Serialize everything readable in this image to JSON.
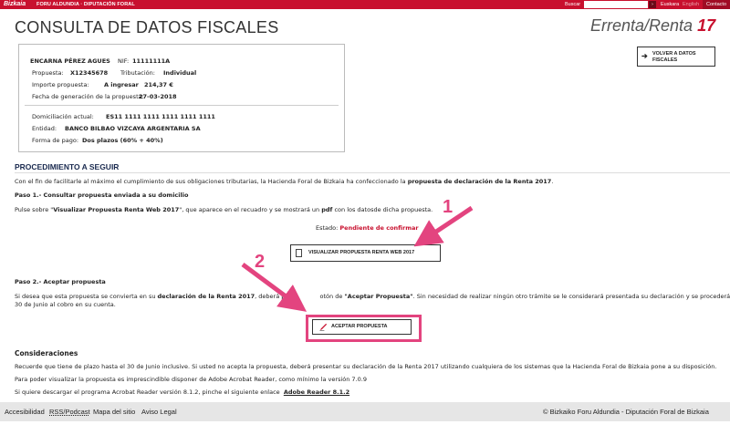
{
  "topbar": {
    "logo": "Bizkaia",
    "org": "FORU ALDUNDIA · DIPUTACIÓN FORAL",
    "search_label": "Buscar",
    "search_go": "›",
    "lang_eu": "Euskara",
    "lang_en": "English",
    "contact": "Contacto"
  },
  "header": {
    "title": "CONSULTA DE DATOS FISCALES",
    "brand_main": "Errenta/Renta",
    "brand_year": "17",
    "back_button": "VOLVER A DATOS FISCALES"
  },
  "info": {
    "name": "ENCARNA PÉREZ AGUES",
    "nif_label": "NIF:",
    "nif": "11111111A",
    "propuesta_label": "Propuesta:",
    "propuesta": "X12345678",
    "tributacion_label": "Tributación:",
    "tributacion": "Individual",
    "importe_label": "Importe propuesta:",
    "importe_tipo": "A ingresar",
    "importe": "214,37 €",
    "fecha_label": "Fecha de generación de la propuesta:",
    "fecha": "27-03-2018",
    "domiciliacion_label": "Domiciliación actual:",
    "domiciliacion": "ES11 1111 1111 1111 1111 1111",
    "entidad_label": "Entidad:",
    "entidad": "BANCO BILBAO VIZCAYA ARGENTARIA SA",
    "forma_label": "Forma de pago:",
    "forma": "Dos plazos (60% + 40%)"
  },
  "procedure": {
    "heading": "PROCEDIMIENTO A SEGUIR",
    "intro_a": "Con el fin de facilitarle al máximo el cumplimiento de sus obligaciones tributarias, la Hacienda Foral de Bizkaia ha confeccionado la ",
    "intro_b": "propuesta de declaración de la Renta 2017",
    "intro_c": ".",
    "step1_title": "Paso 1.- Consultar propuesta enviada a su domicilio",
    "step1_a": "Pulse sobre \"",
    "step1_b": "Visualizar Propuesta Renta Web 2017",
    "step1_c": "\", que aparece en el recuadro y se mostrará un ",
    "step1_d": "pdf",
    "step1_e": " con los datosde dicha propuesta.",
    "estado_label": "Estado:",
    "estado": "Pendiente de confirmar",
    "view_button": "VISUALIZAR PROPUESTA RENTA WEB 2017",
    "step2_title": "Paso 2.- Aceptar propuesta",
    "step2_a": "Si desea que esta propuesta se convierta en su ",
    "step2_b": "declaración de la Renta 2017",
    "step2_c": ", deberá pu",
    "step2_d": "otón de ",
    "step2_e": "\"Aceptar Propuesta\"",
    "step2_f": ". Sin necesidad de realizar ningún otro trámite se le considerará presentada su declaración y se procederá a partir del",
    "step2_line2": "30 de Junio al cobro en su cuenta.",
    "accept_button": "ACEPTAR PROPUESTA"
  },
  "considerations": {
    "heading": "Consideraciones",
    "line1": "Recuerde que tiene de plazo hasta el 30 de Junio inclusive. Si usted no acepta la propuesta, deberá presentar su declaración de la Renta 2017 utilizando cualquiera de los sistemas que la Hacienda Foral de Bizkaia pone a su disposición.",
    "line2": "Para poder visualizar la propuesta es imprescindible disponer de Adobe Acrobat Reader, como mínimo la versión 7.0.9",
    "line3": "Si quiere descargar el programa Acrobat Reader versión 8.1.2, pinche el siguiente enlace",
    "line3_link": "Adobe Reader 8.1.2"
  },
  "annotations": {
    "one": "1",
    "two": "2",
    "color": "#e3447f"
  },
  "footer": {
    "accesibilidad": "Accesibilidad",
    "rss": "RSS/Podcast",
    "mapa": "Mapa del sitio",
    "aviso": "Aviso Legal",
    "copyright": "© Bizkaiko Foru Aldundia - Diputación Foral de Bizkaia"
  }
}
